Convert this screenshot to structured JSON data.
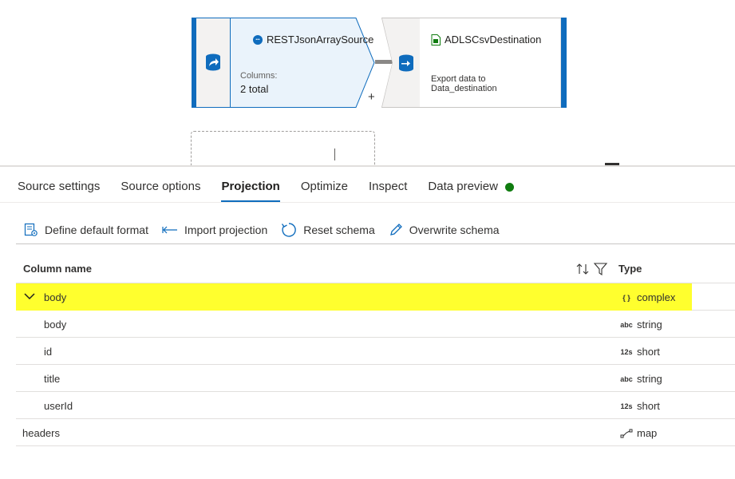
{
  "canvas": {
    "source_node": {
      "title": "RESTJsonArraySource",
      "columns_label": "Columns:",
      "columns_value": "2 total",
      "icon": "rest-source-icon"
    },
    "plus_label": "+",
    "destination_node": {
      "title": "ADLSCsvDestination",
      "description_line1": "Export data to",
      "description_line2": "Data_destination",
      "icon": "csv-sink-icon"
    }
  },
  "tabs": [
    {
      "label": "Source settings"
    },
    {
      "label": "Source options"
    },
    {
      "label": "Projection",
      "active": true
    },
    {
      "label": "Optimize"
    },
    {
      "label": "Inspect"
    },
    {
      "label": "Data preview",
      "status": "green"
    }
  ],
  "toolbar": {
    "define_default_format": "Define default format",
    "import_projection": "Import projection",
    "reset_schema": "Reset schema",
    "overwrite_schema": "Overwrite schema"
  },
  "grid": {
    "col_name": "Column name",
    "col_type": "Type",
    "rows": [
      {
        "name": "body",
        "type": "complex",
        "type_icon": "{ }",
        "expanded": true,
        "highlight": true,
        "level": 0
      },
      {
        "name": "body",
        "type": "string",
        "type_icon": "abc",
        "level": 1
      },
      {
        "name": "id",
        "type": "short",
        "type_icon": "12s",
        "level": 1
      },
      {
        "name": "title",
        "type": "string",
        "type_icon": "abc",
        "level": 1
      },
      {
        "name": "userId",
        "type": "short",
        "type_icon": "12s",
        "level": 1
      },
      {
        "name": "headers",
        "type": "map",
        "type_icon": "map-icon",
        "level": 0
      }
    ]
  },
  "colors": {
    "accent": "#0f6cbd",
    "highlight": "#ffff2e",
    "status_green": "#107c10"
  }
}
